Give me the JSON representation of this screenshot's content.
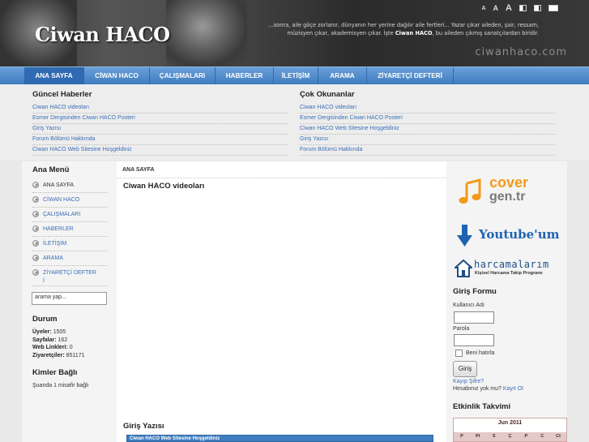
{
  "header": {
    "site_title": "Ciwan HACO",
    "tagline_pre": "...sonra, aile göçe zorlanır, dünyanın her yerine dağılır aile fertleri... Yazar çıkar aileden, şair, ressam, müzisyen çıkar, akademisyen çıkar. İşte",
    "tagline_bold": "Ciwan HACO",
    "tagline_post": ", bu aileden çıkmış sanatçılardan biridir.",
    "watermark": "ciwanhaco.com",
    "font_sizes": [
      "A",
      "A",
      "A"
    ]
  },
  "nav": {
    "items": [
      {
        "label": "ANA SAYFA"
      },
      {
        "label": "CİWAN HACO"
      },
      {
        "label": "ÇALIŞMALARI"
      },
      {
        "label": "HABERLER"
      },
      {
        "label": "İLETİŞİM"
      },
      {
        "label": "ARAMA"
      },
      {
        "label": "ZİYARETÇİ DEFTERİ"
      }
    ]
  },
  "news": {
    "current_title": "Güncel Haberler",
    "current_items": [
      "Ciwan HACO videoları",
      "Esmer Dergisinden Ciwan HACO Posteri",
      "Giriş Yazısı",
      "Forum Bölümü Hakkında",
      "Ciwan HACO Web Sitesine Hoşgeldiniz"
    ],
    "popular_title": "Çok Okunanlar",
    "popular_items": [
      "Ciwan HACO videoları",
      "Esmer Dergisinden Ciwan HACO Posteri",
      "Ciwan HACO Web Sitesine Hoşgeldiniz",
      "Giriş Yazısı",
      "Forum Bölümü Hakkında"
    ]
  },
  "left_sidebar": {
    "menu_title": "Ana Menü",
    "menu_items": [
      "ANA SAYFA",
      "CİWAN HACO",
      "ÇALIŞMALARI",
      "HABERLER",
      "İLETİŞİM",
      "ARAMA",
      "ZİYARETÇİ DEFTER",
      "İ"
    ],
    "search_value": "arama yap...",
    "status_title": "Durum",
    "stats": [
      {
        "label": "Üyeler:",
        "value": "1505"
      },
      {
        "label": "Sayfalar:",
        "value": "162"
      },
      {
        "label": "Web Linkleri:",
        "value": "0"
      },
      {
        "label": "Ziyaretçiler:",
        "value": "851171"
      }
    ],
    "online_title": "Kimler Bağlı",
    "online_text": "Şuanda 1 misafir bağlı"
  },
  "content": {
    "breadcrumb": "ANA SAYFA",
    "heading1": "Ciwan HACO videoları",
    "heading2": "Giriş Yazısı",
    "bar_text": "Ciwan HACO Web Sitesine Hoşgeldiniz"
  },
  "right_sidebar": {
    "banner1_line1": "cover",
    "banner1_line2": "gen.tr",
    "banner2": "Youtube'um",
    "banner3_title": "harcamalarım",
    "banner3_sub": "Kişisel Harcama Takip Programı",
    "login_title": "Giriş Formu",
    "username_label": "Kullanıcı Adı",
    "password_label": "Parola",
    "remember_label": "Beni hatırla",
    "login_button": "Giriş",
    "forgot_link": "Kayıp Şifre?",
    "no_account_text": "Hesabınız yok mu?",
    "register_link": "Kayıt Ol",
    "calendar_title": "Etkinlik Takvimi",
    "calendar_month": "Jun 2011",
    "calendar_days": [
      "P",
      "Pt",
      "S",
      "Ç",
      "P",
      "C",
      "Ct"
    ]
  },
  "colors": {
    "nav_blue": "#3f7cc0",
    "link_blue": "#3b6db5",
    "youtube_blue": "#1f63b2",
    "cover_orange": "#f39a1a"
  }
}
